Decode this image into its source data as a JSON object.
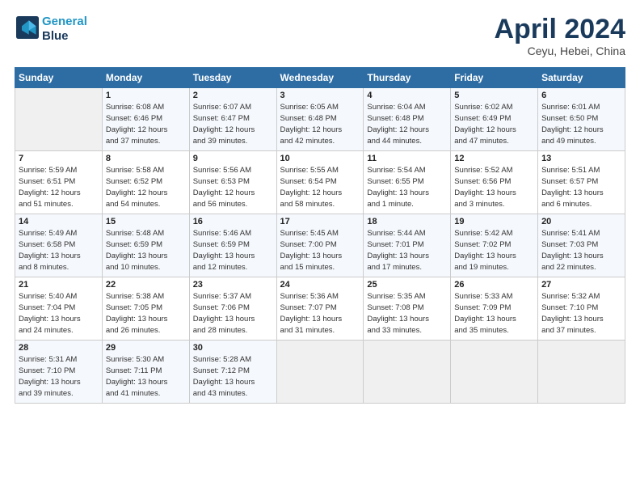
{
  "header": {
    "logo_line1": "General",
    "logo_line2": "Blue",
    "month": "April 2024",
    "location": "Ceyu, Hebei, China"
  },
  "days_of_week": [
    "Sunday",
    "Monday",
    "Tuesday",
    "Wednesday",
    "Thursday",
    "Friday",
    "Saturday"
  ],
  "weeks": [
    [
      {
        "num": "",
        "info": ""
      },
      {
        "num": "1",
        "info": "Sunrise: 6:08 AM\nSunset: 6:46 PM\nDaylight: 12 hours\nand 37 minutes."
      },
      {
        "num": "2",
        "info": "Sunrise: 6:07 AM\nSunset: 6:47 PM\nDaylight: 12 hours\nand 39 minutes."
      },
      {
        "num": "3",
        "info": "Sunrise: 6:05 AM\nSunset: 6:48 PM\nDaylight: 12 hours\nand 42 minutes."
      },
      {
        "num": "4",
        "info": "Sunrise: 6:04 AM\nSunset: 6:48 PM\nDaylight: 12 hours\nand 44 minutes."
      },
      {
        "num": "5",
        "info": "Sunrise: 6:02 AM\nSunset: 6:49 PM\nDaylight: 12 hours\nand 47 minutes."
      },
      {
        "num": "6",
        "info": "Sunrise: 6:01 AM\nSunset: 6:50 PM\nDaylight: 12 hours\nand 49 minutes."
      }
    ],
    [
      {
        "num": "7",
        "info": "Sunrise: 5:59 AM\nSunset: 6:51 PM\nDaylight: 12 hours\nand 51 minutes."
      },
      {
        "num": "8",
        "info": "Sunrise: 5:58 AM\nSunset: 6:52 PM\nDaylight: 12 hours\nand 54 minutes."
      },
      {
        "num": "9",
        "info": "Sunrise: 5:56 AM\nSunset: 6:53 PM\nDaylight: 12 hours\nand 56 minutes."
      },
      {
        "num": "10",
        "info": "Sunrise: 5:55 AM\nSunset: 6:54 PM\nDaylight: 12 hours\nand 58 minutes."
      },
      {
        "num": "11",
        "info": "Sunrise: 5:54 AM\nSunset: 6:55 PM\nDaylight: 13 hours\nand 1 minute."
      },
      {
        "num": "12",
        "info": "Sunrise: 5:52 AM\nSunset: 6:56 PM\nDaylight: 13 hours\nand 3 minutes."
      },
      {
        "num": "13",
        "info": "Sunrise: 5:51 AM\nSunset: 6:57 PM\nDaylight: 13 hours\nand 6 minutes."
      }
    ],
    [
      {
        "num": "14",
        "info": "Sunrise: 5:49 AM\nSunset: 6:58 PM\nDaylight: 13 hours\nand 8 minutes."
      },
      {
        "num": "15",
        "info": "Sunrise: 5:48 AM\nSunset: 6:59 PM\nDaylight: 13 hours\nand 10 minutes."
      },
      {
        "num": "16",
        "info": "Sunrise: 5:46 AM\nSunset: 6:59 PM\nDaylight: 13 hours\nand 12 minutes."
      },
      {
        "num": "17",
        "info": "Sunrise: 5:45 AM\nSunset: 7:00 PM\nDaylight: 13 hours\nand 15 minutes."
      },
      {
        "num": "18",
        "info": "Sunrise: 5:44 AM\nSunset: 7:01 PM\nDaylight: 13 hours\nand 17 minutes."
      },
      {
        "num": "19",
        "info": "Sunrise: 5:42 AM\nSunset: 7:02 PM\nDaylight: 13 hours\nand 19 minutes."
      },
      {
        "num": "20",
        "info": "Sunrise: 5:41 AM\nSunset: 7:03 PM\nDaylight: 13 hours\nand 22 minutes."
      }
    ],
    [
      {
        "num": "21",
        "info": "Sunrise: 5:40 AM\nSunset: 7:04 PM\nDaylight: 13 hours\nand 24 minutes."
      },
      {
        "num": "22",
        "info": "Sunrise: 5:38 AM\nSunset: 7:05 PM\nDaylight: 13 hours\nand 26 minutes."
      },
      {
        "num": "23",
        "info": "Sunrise: 5:37 AM\nSunset: 7:06 PM\nDaylight: 13 hours\nand 28 minutes."
      },
      {
        "num": "24",
        "info": "Sunrise: 5:36 AM\nSunset: 7:07 PM\nDaylight: 13 hours\nand 31 minutes."
      },
      {
        "num": "25",
        "info": "Sunrise: 5:35 AM\nSunset: 7:08 PM\nDaylight: 13 hours\nand 33 minutes."
      },
      {
        "num": "26",
        "info": "Sunrise: 5:33 AM\nSunset: 7:09 PM\nDaylight: 13 hours\nand 35 minutes."
      },
      {
        "num": "27",
        "info": "Sunrise: 5:32 AM\nSunset: 7:10 PM\nDaylight: 13 hours\nand 37 minutes."
      }
    ],
    [
      {
        "num": "28",
        "info": "Sunrise: 5:31 AM\nSunset: 7:10 PM\nDaylight: 13 hours\nand 39 minutes."
      },
      {
        "num": "29",
        "info": "Sunrise: 5:30 AM\nSunset: 7:11 PM\nDaylight: 13 hours\nand 41 minutes."
      },
      {
        "num": "30",
        "info": "Sunrise: 5:28 AM\nSunset: 7:12 PM\nDaylight: 13 hours\nand 43 minutes."
      },
      {
        "num": "",
        "info": ""
      },
      {
        "num": "",
        "info": ""
      },
      {
        "num": "",
        "info": ""
      },
      {
        "num": "",
        "info": ""
      }
    ]
  ]
}
